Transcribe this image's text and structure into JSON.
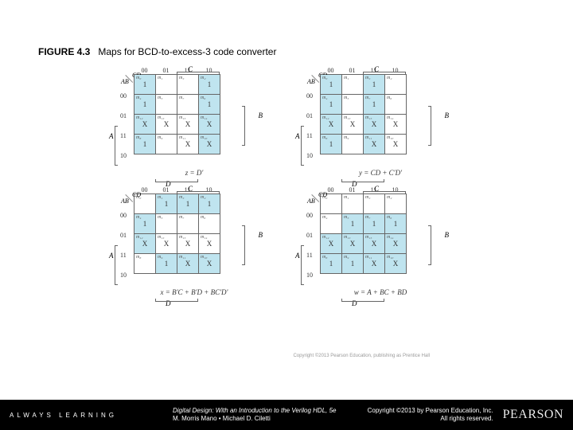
{
  "figure": {
    "label": "FIGURE 4.3",
    "title": "Maps for BCD-to-excess-3 code converter"
  },
  "kmap_common": {
    "col_headers": [
      "00",
      "01",
      "11",
      "10"
    ],
    "row_headers": [
      "00",
      "01",
      "11",
      "10"
    ],
    "diag_cd": "CD",
    "diag_ab": "AB",
    "var_c": "C",
    "var_d": "D",
    "var_a": "A",
    "var_b": "B",
    "minterms": [
      [
        "m₀",
        "m₁",
        "m₃",
        "m₂"
      ],
      [
        "m₄",
        "m₅",
        "m₇",
        "m₆"
      ],
      [
        "m₁₂",
        "m₁₃",
        "m₁₅",
        "m₁₄"
      ],
      [
        "m₈",
        "m₉",
        "m₁₁",
        "m₁₀"
      ]
    ]
  },
  "maps": {
    "z": {
      "equation": "z = D'",
      "cells": [
        {
          "v": "1",
          "sh": true
        },
        {
          "v": "",
          "sh": false
        },
        {
          "v": "",
          "sh": false
        },
        {
          "v": "1",
          "sh": true
        },
        {
          "v": "1",
          "sh": true
        },
        {
          "v": "",
          "sh": false
        },
        {
          "v": "",
          "sh": false
        },
        {
          "v": "1",
          "sh": true
        },
        {
          "v": "X",
          "sh": true
        },
        {
          "v": "X",
          "sh": false
        },
        {
          "v": "X",
          "sh": false
        },
        {
          "v": "X",
          "sh": true
        },
        {
          "v": "1",
          "sh": true
        },
        {
          "v": "",
          "sh": false
        },
        {
          "v": "X",
          "sh": false
        },
        {
          "v": "X",
          "sh": true
        }
      ]
    },
    "y": {
      "equation": "y = CD + C'D'",
      "cells": [
        {
          "v": "1",
          "sh": true
        },
        {
          "v": "",
          "sh": false
        },
        {
          "v": "1",
          "sh": true
        },
        {
          "v": "",
          "sh": false
        },
        {
          "v": "1",
          "sh": true
        },
        {
          "v": "",
          "sh": false
        },
        {
          "v": "1",
          "sh": true
        },
        {
          "v": "",
          "sh": false
        },
        {
          "v": "X",
          "sh": true
        },
        {
          "v": "X",
          "sh": false
        },
        {
          "v": "X",
          "sh": true
        },
        {
          "v": "X",
          "sh": false
        },
        {
          "v": "1",
          "sh": true
        },
        {
          "v": "",
          "sh": false
        },
        {
          "v": "X",
          "sh": true
        },
        {
          "v": "X",
          "sh": false
        }
      ]
    },
    "x": {
      "equation": "x = B'C + B'D + BC'D'",
      "cells": [
        {
          "v": "",
          "sh": false
        },
        {
          "v": "1",
          "sh": true
        },
        {
          "v": "1",
          "sh": true
        },
        {
          "v": "1",
          "sh": true
        },
        {
          "v": "1",
          "sh": true
        },
        {
          "v": "",
          "sh": false
        },
        {
          "v": "",
          "sh": false
        },
        {
          "v": "",
          "sh": false
        },
        {
          "v": "X",
          "sh": true
        },
        {
          "v": "X",
          "sh": false
        },
        {
          "v": "X",
          "sh": false
        },
        {
          "v": "X",
          "sh": false
        },
        {
          "v": "",
          "sh": false
        },
        {
          "v": "1",
          "sh": true
        },
        {
          "v": "X",
          "sh": true
        },
        {
          "v": "X",
          "sh": true
        }
      ]
    },
    "w": {
      "equation": "w = A + BC + BD",
      "cells": [
        {
          "v": "",
          "sh": false
        },
        {
          "v": "",
          "sh": false
        },
        {
          "v": "",
          "sh": false
        },
        {
          "v": "",
          "sh": false
        },
        {
          "v": "",
          "sh": false
        },
        {
          "v": "1",
          "sh": true
        },
        {
          "v": "1",
          "sh": true
        },
        {
          "v": "1",
          "sh": true
        },
        {
          "v": "X",
          "sh": true
        },
        {
          "v": "X",
          "sh": true
        },
        {
          "v": "X",
          "sh": true
        },
        {
          "v": "X",
          "sh": true
        },
        {
          "v": "1",
          "sh": true
        },
        {
          "v": "1",
          "sh": true
        },
        {
          "v": "X",
          "sh": true
        },
        {
          "v": "X",
          "sh": true
        }
      ]
    }
  },
  "copy_small": "Copyright ©2013 Pearson Education, publishing as Prentice Hall",
  "footer": {
    "always": "ALWAYS LEARNING",
    "book_title": "Digital Design: With an Introduction to the Verilog HDL, 5e",
    "authors": "M. Morris Mano • Michael D. Ciletti",
    "copyright_1": "Copyright ©2013 by Pearson Education, Inc.",
    "copyright_2": "All rights reserved.",
    "logo": "PEARSON"
  }
}
